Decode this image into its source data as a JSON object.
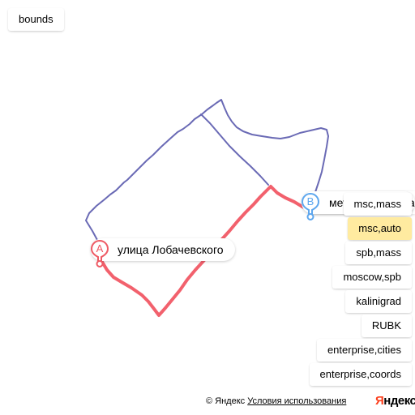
{
  "controls": {
    "bounds_label": "bounds"
  },
  "route_options": [
    {
      "label": "msc,mass",
      "selected": false
    },
    {
      "label": "msc,auto",
      "selected": true
    },
    {
      "label": "spb,mass",
      "selected": false
    },
    {
      "label": "moscow,spb",
      "selected": false
    },
    {
      "label": "kalinigrad",
      "selected": false
    },
    {
      "label": "RUBK",
      "selected": false
    },
    {
      "label": "enterprise,cities",
      "selected": false
    },
    {
      "label": "enterprise,coords",
      "selected": false
    }
  ],
  "points": {
    "a": {
      "letter": "A",
      "label": "улица Лобачевского",
      "color": "#ee5a64"
    },
    "b": {
      "letter": "B",
      "label": "метро Юго-Западная",
      "color": "#5ea7ee"
    }
  },
  "routes": {
    "main_color": "#f2616d",
    "alt_color": "#6a6ab5"
  },
  "footer": {
    "copyright": "© Яндекс",
    "terms": "Условия использования",
    "logo_red": "Я",
    "logo_black": "ндекс"
  }
}
